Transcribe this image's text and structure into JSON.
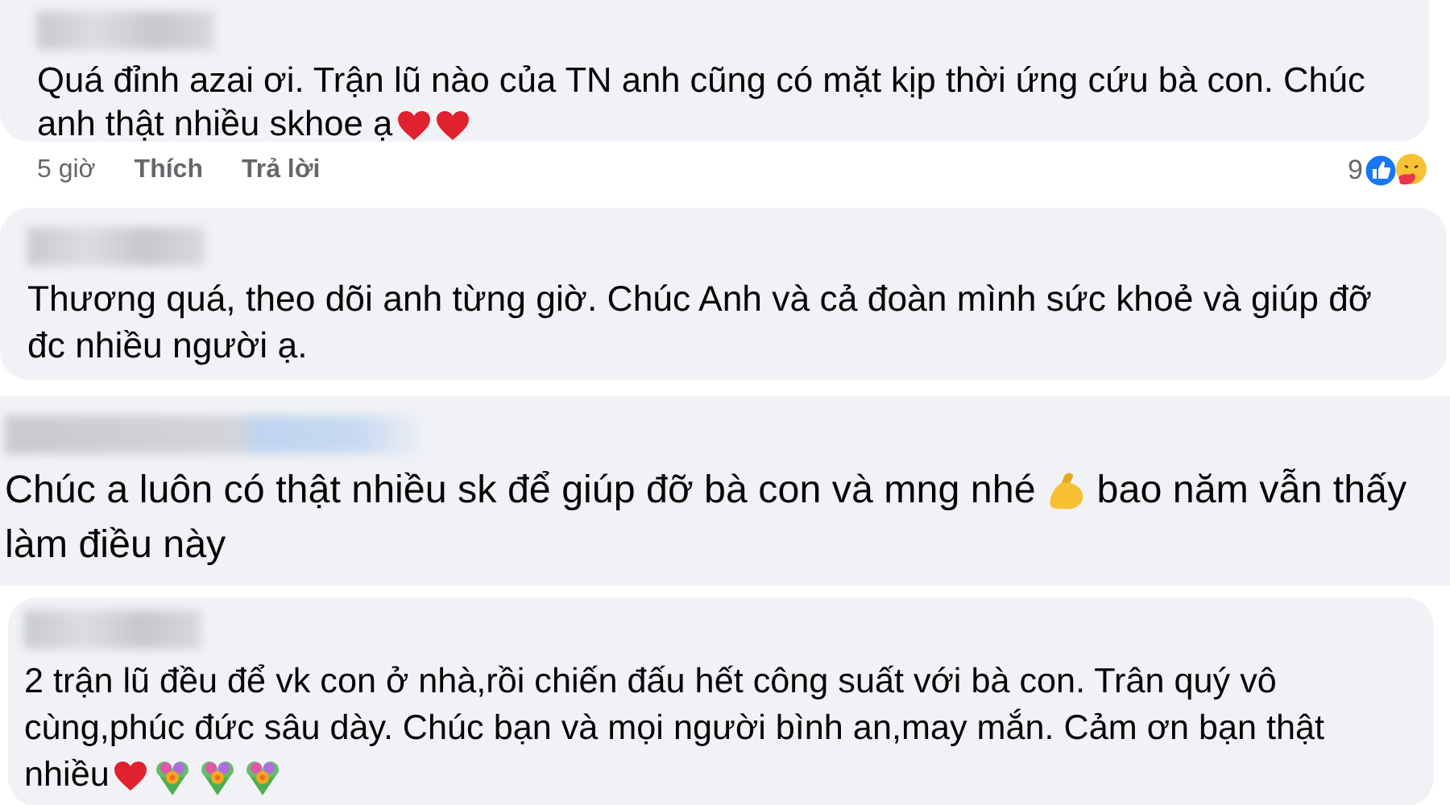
{
  "comments": [
    {
      "redacted_name": true,
      "lines": [
        [
          {
            "kind": "text",
            "text": "Quá đỉnh azai ơi. Trận lũ nào của TN anh cũng có mặt kịp thời ứng cứu bà con. Chúc"
          }
        ],
        [
          {
            "kind": "text",
            "text": "anh thật nhiều skhoe ạ"
          },
          {
            "kind": "heart"
          },
          {
            "kind": "heart"
          }
        ]
      ],
      "actions": {
        "time": "5 giờ",
        "like": "Thích",
        "reply": "Trả lời",
        "reaction_count": "9"
      }
    },
    {
      "redacted_name": true,
      "lines": [
        [
          {
            "kind": "text",
            "text": "Thương quá, theo dõi anh từng giờ. Chúc Anh và cả đoàn mình sức khoẻ và giúp đỡ"
          }
        ],
        [
          {
            "kind": "text",
            "text": "đc nhiều người ạ."
          }
        ]
      ]
    },
    {
      "redacted_name": true,
      "lines": [
        [
          {
            "kind": "text",
            "text": "Chúc a luôn có thật nhiều sk để giúp đỡ bà con và mng nhé"
          },
          {
            "kind": "muscle"
          },
          {
            "kind": "text",
            "text": "bao năm vẫn thấy"
          }
        ],
        [
          {
            "kind": "text",
            "text": "làm điều này"
          }
        ]
      ]
    },
    {
      "redacted_name": true,
      "lines": [
        [
          {
            "kind": "text",
            "text": "2 trận lũ đều để vk con ở nhà,rồi chiến đấu hết công suất với bà con. Trân quý vô"
          }
        ],
        [
          {
            "kind": "text",
            "text": "cùng,phúc đức sâu dày. Chúc bạn và mọi người bình an,may mắn. Cảm ơn bạn thật"
          }
        ],
        [
          {
            "kind": "text",
            "text": "nhiều"
          },
          {
            "kind": "heart"
          },
          {
            "kind": "bouquet"
          },
          {
            "kind": "bouquet"
          },
          {
            "kind": "bouquet"
          }
        ]
      ]
    }
  ]
}
